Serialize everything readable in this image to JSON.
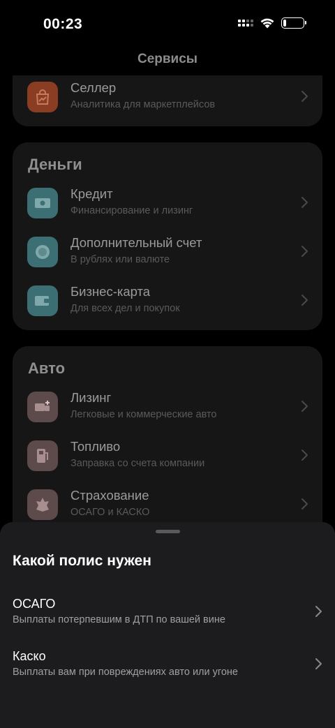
{
  "status_bar": {
    "time": "00:23",
    "battery_level": 0.15
  },
  "nav": {
    "title": "Сервисы"
  },
  "top_card": {
    "items": [
      {
        "title": "Селлер",
        "subtitle": "Аналитика для маркетплейсов",
        "icon": "shopping-bag-chart-icon",
        "icon_color": "#8a3d22"
      }
    ]
  },
  "money": {
    "title": "Деньги",
    "items": [
      {
        "title": "Кредит",
        "subtitle": "Финансирование и лизинг",
        "icon": "banknote-icon",
        "icon_color": "#3c6f74"
      },
      {
        "title": "Дополнительный счет",
        "subtitle": "В рублях или валюте",
        "icon": "coin-icon",
        "icon_color": "#3c6f74"
      },
      {
        "title": "Бизнес-карта",
        "subtitle": "Для всех дел и покупок",
        "icon": "card-icon",
        "icon_color": "#3c6f74"
      }
    ]
  },
  "auto": {
    "title": "Авто",
    "items": [
      {
        "title": "Лизинг",
        "subtitle": "Легковые и коммерческие авто",
        "icon": "truck-plus-icon",
        "icon_color": "#5d4a4a"
      },
      {
        "title": "Топливо",
        "subtitle": "Заправка со счета компании",
        "icon": "fuel-pump-icon",
        "icon_color": "#5d4a4a"
      },
      {
        "title": "Страхование",
        "subtitle": "ОСАГО и КАСКО",
        "icon": "shield-leaf-icon",
        "icon_color": "#5d4a4a"
      }
    ]
  },
  "sheet": {
    "title": "Какой полис нужен",
    "options": [
      {
        "title": "ОСАГО",
        "subtitle": "Выплаты потерпевшим в ДТП по вашей вине"
      },
      {
        "title": "Каско",
        "subtitle": "Выплаты вам при повреждениях авто или угоне"
      }
    ]
  }
}
